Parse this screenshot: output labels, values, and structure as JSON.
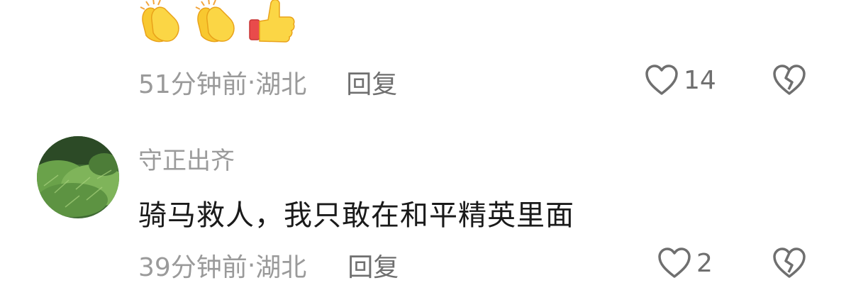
{
  "comments": [
    {
      "emojis": [
        "clapping-hands",
        "clapping-hands",
        "thumbs-up"
      ],
      "time": "51分钟前",
      "separator": " · ",
      "location": "湖北",
      "reply_label": "回复",
      "like_count": "14"
    },
    {
      "username": "守正出齐",
      "avatar": "green-bamboo-avatar",
      "text": "骑马救人，我只敢在和平精英里面",
      "time": "39分钟前",
      "separator": " · ",
      "location": "湖北",
      "reply_label": "回复",
      "like_count": "2"
    }
  ],
  "icons": {
    "like": "heart-outline-icon",
    "dislike": "broken-heart-icon"
  },
  "colors": {
    "meta_text": "#9a9a9a",
    "action_text": "#6f6f6f",
    "comment_text": "#1a1a1a",
    "emoji_yellow": "#f7c42c",
    "emoji_red": "#e94b4b"
  }
}
